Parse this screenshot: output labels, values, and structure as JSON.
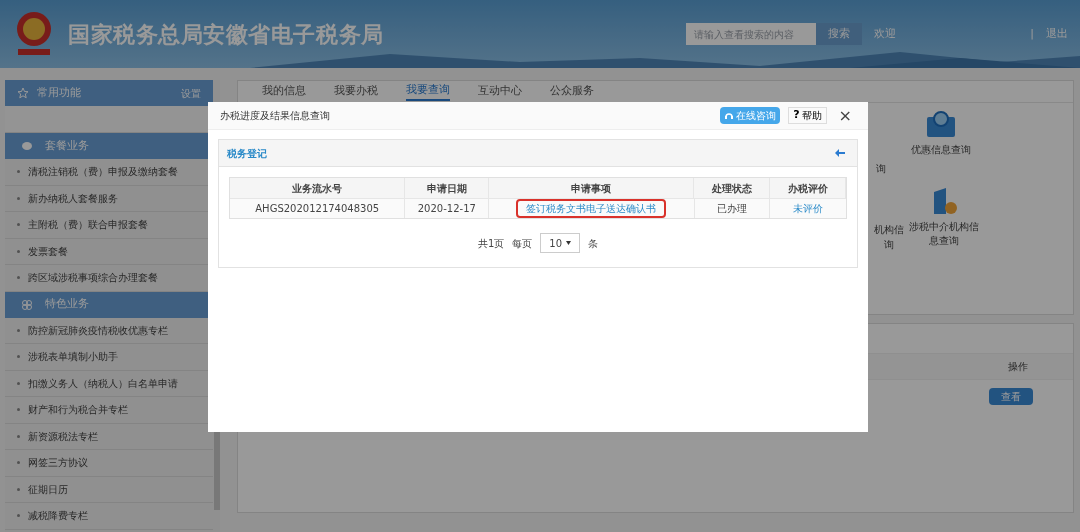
{
  "header": {
    "title": "国家税务总局安徽省电子税务局",
    "search": {
      "placeholder": "请输入查看搜索的内容",
      "button": "搜索"
    },
    "welcome": "欢迎",
    "separator": "|",
    "logout": "退出"
  },
  "sidebar": {
    "favorites": {
      "title": "常用功能",
      "action": "设置"
    },
    "sections": [
      {
        "title": "套餐业务",
        "kind": "package",
        "items": [
          "清税注销税（费）申报及缴纳套餐",
          "新办纳税人套餐服务",
          "主附税（费）联合申报套餐",
          "发票套餐",
          "跨区域涉税事项综合办理套餐"
        ]
      },
      {
        "title": "特色业务",
        "kind": "feature",
        "items": [
          "防控新冠肺炎疫情税收优惠专栏",
          "涉税表单填制小助手",
          "扣缴义务人（纳税人）白名单申请",
          "财产和行为税合并专栏",
          "新资源税法专栏",
          "网签三方协议",
          "征期日历",
          "减税降费专栏"
        ]
      }
    ]
  },
  "tabs": [
    {
      "label": "我的信息",
      "selected": false
    },
    {
      "label": "我要办税",
      "selected": false
    },
    {
      "label": "我要查询",
      "selected": true
    },
    {
      "label": "互动中心",
      "selected": false
    },
    {
      "label": "公众服务",
      "selected": false
    }
  ],
  "cut_tiles": [
    {
      "lines": [
        "询"
      ]
    },
    {
      "lines": [
        "机构信",
        "询"
      ]
    }
  ],
  "query_tiles": [
    {
      "label": "优惠信息查询",
      "kind": "search"
    },
    {
      "label": "涉税中介机构信息查询",
      "kind": "agency"
    }
  ],
  "lower_panel": {
    "column": "操作",
    "button": "查看"
  },
  "dialog": {
    "title": "办税进度及结果信息查询",
    "consult_button": "在线咨询",
    "help_button": "帮助",
    "help_mark": "?",
    "close": "×",
    "panel_title": "税务登记",
    "table": {
      "columns": [
        "业务流水号",
        "申请日期",
        "申请事项",
        "处理状态",
        "办税评价"
      ],
      "rows": [
        {
          "cells": [
            "AHGS202012174048305",
            "2020-12-17",
            "签订税务文书电子送达确认书",
            "已办理",
            "未评价"
          ],
          "highlighted": true
        }
      ]
    },
    "pagination": {
      "pages": "共1页",
      "per_page_label": "每页",
      "per_page": "10",
      "unit": "条"
    }
  }
}
